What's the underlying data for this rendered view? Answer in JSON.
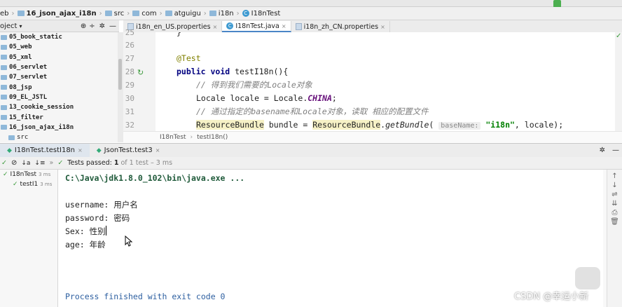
{
  "breadcrumb": {
    "items": [
      "eb",
      "16_json_ajax_i18n",
      "src",
      "com",
      "atguigu",
      "i18n",
      "I18nTest"
    ]
  },
  "project_panel": {
    "title": "oject",
    "items": [
      "05_book_static",
      "05_web",
      "05_xml",
      "06_servlet",
      "07_servlet",
      "08_jsp",
      "09_EL_JSTL",
      "13_cookie_session",
      "15_filter",
      "16_json_ajax_i18n",
      "src"
    ]
  },
  "editor_tabs": [
    {
      "label": "i18n_en_US.properties",
      "active": false
    },
    {
      "label": "I18nTest.java",
      "active": true
    },
    {
      "label": "i18n_zh_CN.properties",
      "active": false
    }
  ],
  "gutter": {
    "lines": [
      "25",
      "26",
      "27",
      "28",
      "29",
      "30",
      "31",
      "32"
    ]
  },
  "code": {
    "l25": "}",
    "l27_annotation": "@Test",
    "l28_kw1": "public",
    "l28_kw2": "void",
    "l28_rest": "testI18n(){",
    "l29_comment": "// 得到我们需要的Locale对象",
    "l30_a": "Locale locale = Locale.",
    "l30_field": "CHINA",
    "l30_end": ";",
    "l31_comment": "// 通过指定的basename和Locale对象，读取 相应的配置文件",
    "l32_type": "ResourceBundle",
    "l32_mid": "bundle = ",
    "l32_type2": "ResourceBundle",
    "l32_dot": ".",
    "l32_method": "getBundle",
    "l32_paren": "(",
    "l32_hint": "baseName:",
    "l32_string": "\"i18n\"",
    "l32_end": ", locale);"
  },
  "editor_breadcrumb": {
    "class": "I18nTest",
    "method": "testI18n()"
  },
  "run_tabs": [
    {
      "label": "I18nTest.testI18n",
      "active": true
    },
    {
      "label": "JsonTest.test3",
      "active": false
    }
  ],
  "test_bar": {
    "passed": "Tests passed:",
    "count": "1",
    "detail": "of 1 test – 3 ms"
  },
  "test_tree": [
    {
      "label": "I18nTest",
      "time": "3 ms"
    },
    {
      "label": "testI1",
      "time": "3 ms"
    }
  ],
  "console": {
    "cmd": "C:\\Java\\jdk1.8.0_102\\bin\\java.exe ...",
    "lines": [
      "username: 用户名",
      "password: 密码",
      "Sex: 性别",
      "age: 年龄"
    ],
    "finished": "Process finished with exit code 0"
  },
  "watermark": "CSDN @幸运小新",
  "colors": {
    "keyword": "#000080",
    "annotation": "#808000",
    "comment": "#808080",
    "string": "#008000",
    "static_field": "#660e7a",
    "current_line": "#fdf8d8"
  }
}
